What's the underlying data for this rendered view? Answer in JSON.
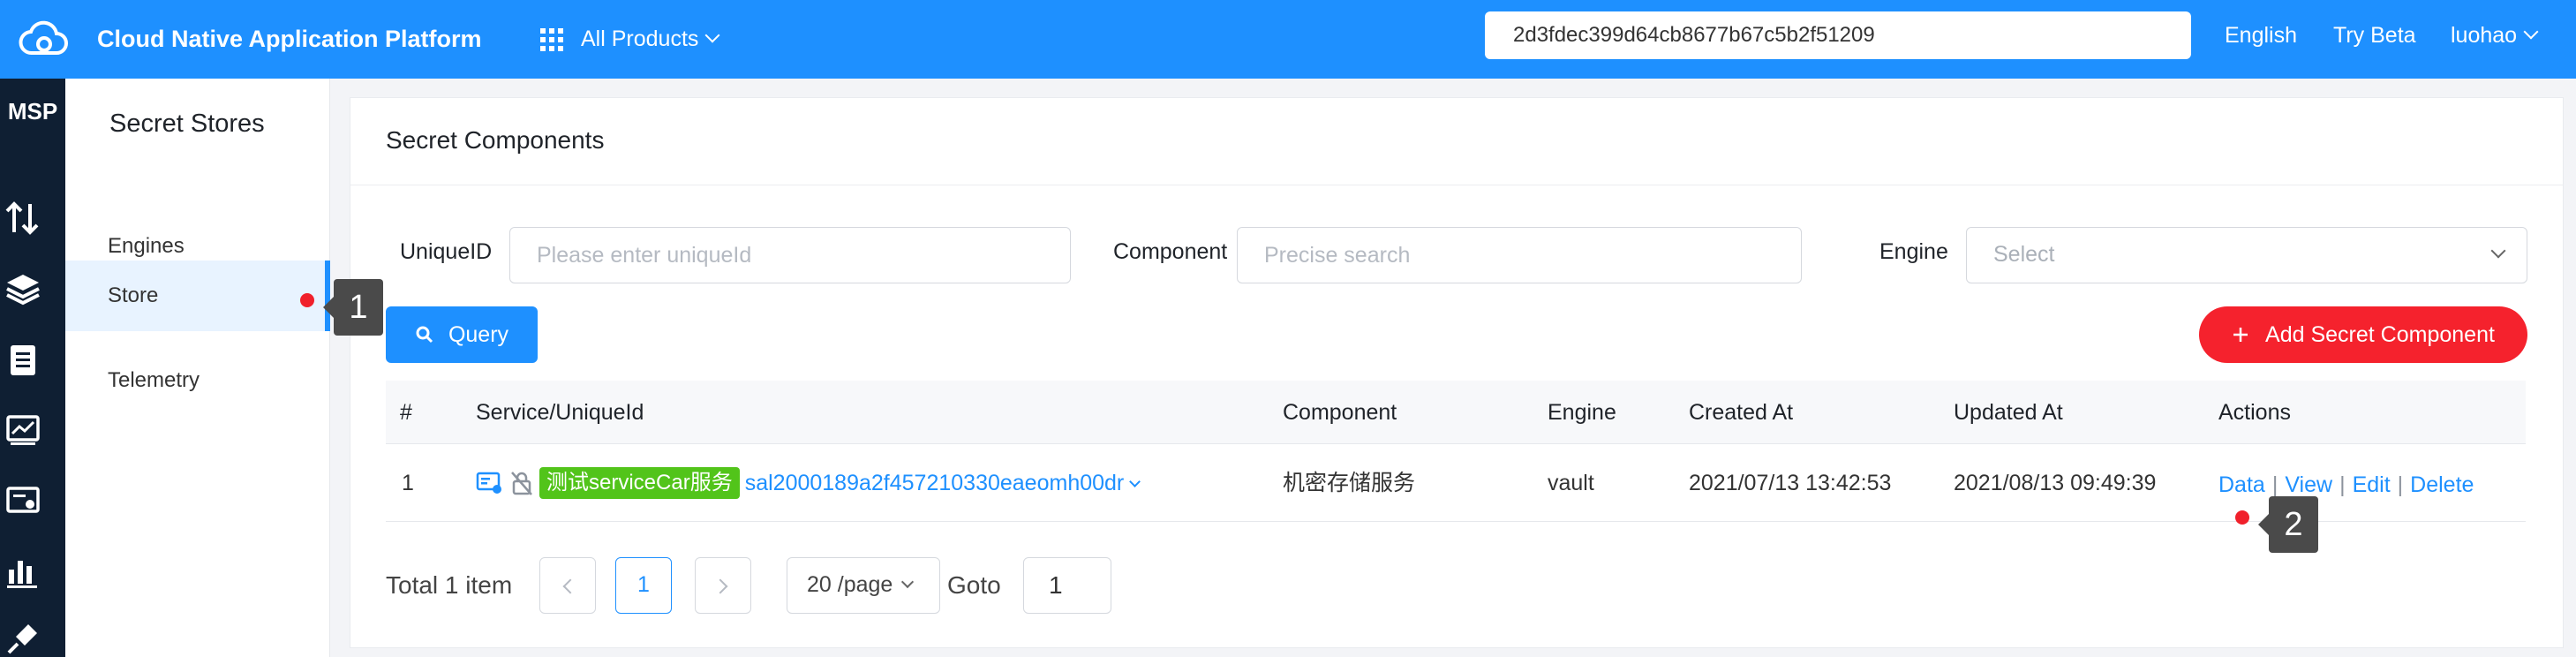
{
  "topbar": {
    "brand": "Cloud Native Application Platform",
    "products_label": "All Products",
    "search_value": "2d3fdec399d64cb8677b67c5b2f51209",
    "language": "English",
    "try_beta": "Try Beta",
    "user": "luohao"
  },
  "rail": {
    "label": "MSP"
  },
  "sidebar": {
    "title": "Secret Stores",
    "items": [
      {
        "label": "Engines"
      },
      {
        "label": "Store"
      },
      {
        "label": "Telemetry"
      }
    ]
  },
  "main": {
    "title": "Secret Components",
    "filters": {
      "uniqueid_label": "UniqueID",
      "uniqueid_placeholder": "Please enter uniqueId",
      "component_label": "Component",
      "component_placeholder": "Precise search",
      "engine_label": "Engine",
      "engine_placeholder": "Select"
    },
    "query_label": "Query",
    "add_label": "Add Secret Component",
    "table": {
      "headers": [
        "#",
        "Service/UniqueId",
        "Component",
        "Engine",
        "Created At",
        "Updated At",
        "Actions"
      ],
      "rows": [
        {
          "index": "1",
          "service_tag": "测试serviceCar服务",
          "unique_id": "sal2000189a2f457210330eaeomh00dr",
          "component": "机密存储服务",
          "engine": "vault",
          "created_at": "2021/07/13 13:42:53",
          "updated_at": "2021/08/13 09:49:39",
          "actions": [
            "Data",
            "View",
            "Edit",
            "Delete"
          ]
        }
      ]
    },
    "pagination": {
      "total": "Total 1 item",
      "current_page": "1",
      "page_size": "20 /page",
      "goto_label": "Goto",
      "goto_value": "1"
    }
  },
  "annotations": [
    "1",
    "2"
  ],
  "colors": {
    "primary": "#1e90ff",
    "danger": "#f5222d",
    "tag_green": "#52c41a",
    "rail_bg": "#0f1f33"
  }
}
